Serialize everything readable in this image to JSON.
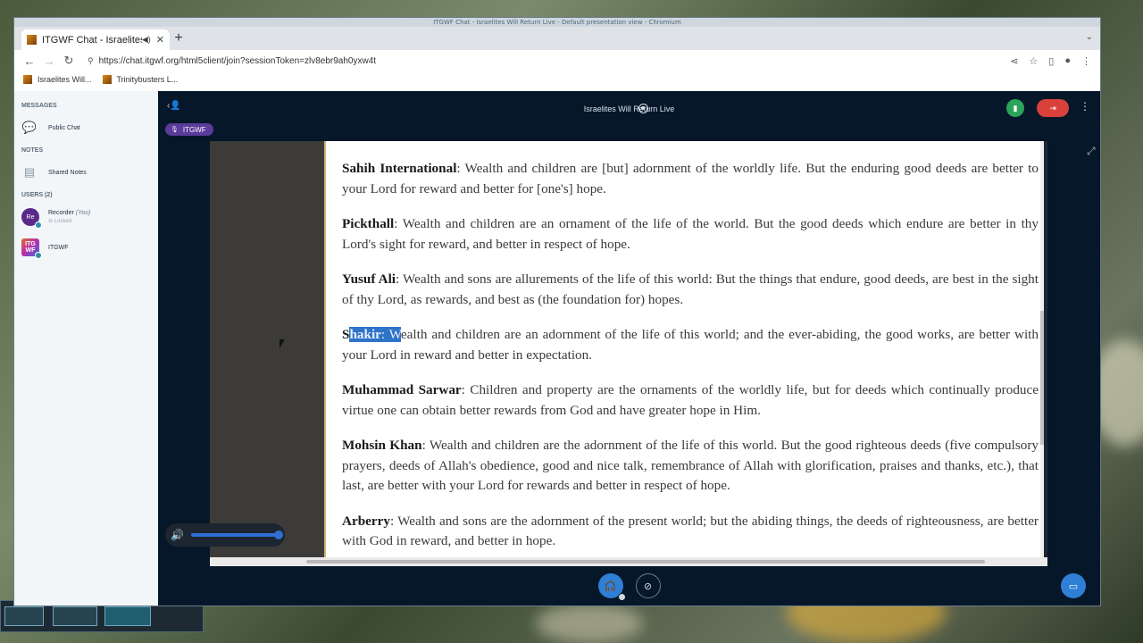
{
  "browser": {
    "window_title": "ITGWF Chat - Israelites Will Return Live - Default presentation view - Chromium",
    "tab_title": "ITGWF Chat - Israelites",
    "tab_close": "✕",
    "new_tab": "+",
    "url": "https://chat.itgwf.org/html5client/join?sessionToken=zlv8ebr9ah0yxw4t",
    "bookmarks": [
      {
        "label": "Israelites Will..."
      },
      {
        "label": "Trinitybusters L..."
      }
    ]
  },
  "sidebar": {
    "messages_title": "MESSAGES",
    "public_chat": "Public Chat",
    "notes_title": "NOTES",
    "shared_notes": "Shared Notes",
    "users_title": "USERS (2)",
    "users": [
      {
        "initials": "Re",
        "name": "Recorder",
        "you": "(You)",
        "status": "Locked"
      },
      {
        "initials": "ITG WF",
        "name": "ITGWF"
      }
    ]
  },
  "meeting": {
    "title": "Israelites Will Return Live",
    "presenter": "ITGWF"
  },
  "document": {
    "verses": [
      {
        "translator": "Sahih International",
        "text": ": Wealth and children are [but] adornment of the worldly life. But the enduring good deeds are better to your Lord for reward and better for [one's] hope."
      },
      {
        "translator": "Pickthall",
        "text": ": Wealth and children are an ornament of the life of the world. But the good deeds which endure are better in thy Lord's sight for reward, and better in respect of hope."
      },
      {
        "translator": "Yusuf Ali",
        "text": ": Wealth and sons are allurements of the life of this world: But the things that endure, good deeds, are best in the sight of thy Lord, as rewards, and best as (the foundation for) hopes."
      },
      {
        "translator_pre": "S",
        "translator_hl": "hakir",
        "hl_rest": ": W",
        "text": "ealth and children are an adornment of the life of this world; and the ever-abiding, the good works, are better with your Lord in reward and better in expectation."
      },
      {
        "translator": "Muhammad Sarwar",
        "text": ": Children and property are the ornaments of the worldly life, but for deeds which continually produce virtue one can obtain better rewards from God and have greater hope in Him."
      },
      {
        "translator": "Mohsin Khan",
        "text": ": Wealth and children are the adornment of the life of this world. But the good righteous deeds (five compulsory prayers, deeds of Allah's obedience, good and nice talk, remembrance of Allah with glorification, praises and thanks, etc.), that last, are better with your Lord for rewards and better in respect of hope."
      },
      {
        "translator": "Arberry",
        "text": ": Wealth and sons are the adornment of the present world; but the abiding things, the deeds of righteousness, are better with God in reward, and better in hope."
      }
    ]
  },
  "controls": {
    "volume_level": 1.0
  }
}
